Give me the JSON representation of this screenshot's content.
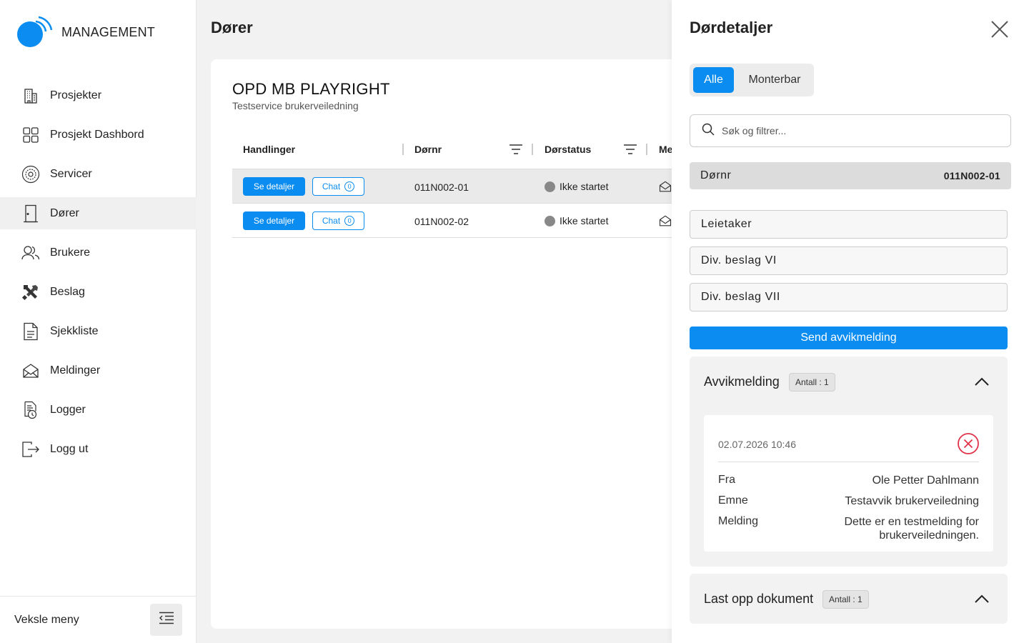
{
  "brand": {
    "name": "MANAGEMENT",
    "color": "#0a8cf0"
  },
  "sidebar": {
    "items": [
      {
        "label": "Prosjekter",
        "icon": "building-icon"
      },
      {
        "label": "Prosjekt Dashbord",
        "icon": "dashboard-grid-icon"
      },
      {
        "label": "Servicer",
        "icon": "service-gear-icon"
      },
      {
        "label": "Dører",
        "icon": "door-icon",
        "active": true
      },
      {
        "label": "Brukere",
        "icon": "users-icon"
      },
      {
        "label": "Beslag",
        "icon": "tools-icon"
      },
      {
        "label": "Sjekkliste",
        "icon": "checklist-icon"
      },
      {
        "label": "Meldinger",
        "icon": "envelope-icon"
      },
      {
        "label": "Logger",
        "icon": "log-icon"
      },
      {
        "label": "Logg ut",
        "icon": "logout-icon"
      }
    ],
    "footer": {
      "toggle_label": "Veksle meny",
      "toggle_icon": "collapse-menu-icon"
    }
  },
  "main": {
    "title": "Dører",
    "project": {
      "name": "OPD MB PLAYRIGHT",
      "subtitle": "Testservice brukerveiledning"
    },
    "table": {
      "columns": [
        "Handlinger",
        "Dørnr",
        "Dørstatus",
        "Me"
      ],
      "rows": [
        {
          "details_label": "Se detaljer",
          "chat_label": "Chat",
          "chat_count": "0",
          "door_no": "011N002-01",
          "status": "Ikke startet"
        },
        {
          "details_label": "Se detaljer",
          "chat_label": "Chat",
          "chat_count": "0",
          "door_no": "011N002-02",
          "status": "Ikke startet"
        }
      ]
    }
  },
  "panel": {
    "title": "Dørdetaljer",
    "tabs": [
      {
        "label": "Alle",
        "selected": true
      },
      {
        "label": "Monterbar",
        "selected": false
      }
    ],
    "search": {
      "placeholder": "Søk og filtrer..."
    },
    "door": {
      "label": "Dørnr",
      "value": "011N002-01"
    },
    "fields": [
      "Leietaker",
      "Div. beslag VI",
      "Div. beslag VII"
    ],
    "send_button": "Send avvikmelding",
    "deviation": {
      "title": "Avvikmelding",
      "badge": "Antall :  1",
      "item": {
        "date": "02.07.2026 10:46",
        "from_label": "Fra",
        "from": "Ole Petter Dahlmann",
        "subject_label": "Emne",
        "subject": "Testavvik brukerveiledning",
        "message_label": "Melding",
        "message": "Dette er en testmelding for brukerveiledningen."
      }
    },
    "upload": {
      "title": "Last opp dokument",
      "badge": "Antall :  1"
    }
  }
}
